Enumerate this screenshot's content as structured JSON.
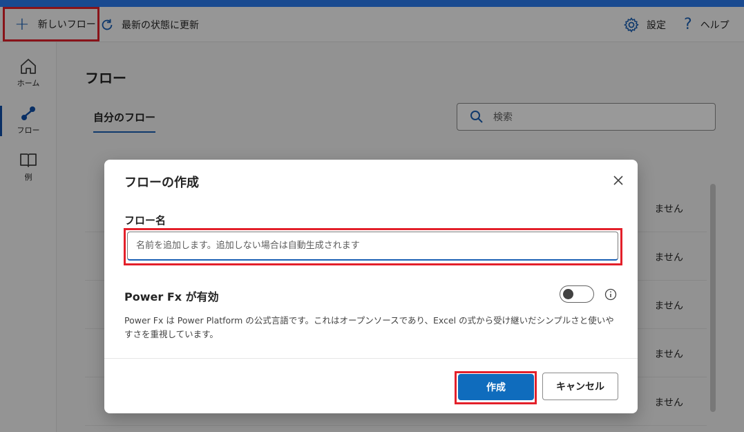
{
  "toolbar": {
    "new_flow_label": "新しいフロー",
    "refresh_label": "最新の状態に更新",
    "settings_label": "設定",
    "help_label": "ヘルプ"
  },
  "leftnav": {
    "items": [
      {
        "label": "ホーム",
        "icon": "home-icon"
      },
      {
        "label": "フロー",
        "icon": "flow-icon"
      },
      {
        "label": "例",
        "icon": "book-icon"
      }
    ],
    "active": "フロー"
  },
  "main": {
    "title": "フロー",
    "tab": "自分のフロー",
    "search_placeholder": "検索",
    "row_status_fragment": "ません"
  },
  "dialog": {
    "title": "フローの作成",
    "field_label": "フロー名",
    "name_value": "",
    "name_placeholder": "名前を追加します。追加しない場合は自動生成されます",
    "powerfx_label": "Power Fx が有効",
    "powerfx_enabled": false,
    "description": "Power Fx は Power Platform の公式言語です。これはオープンソースであり、Excel の式から受け継いだシンプルさと使いやすさを重視しています。",
    "create_label": "作成",
    "cancel_label": "キャンセル"
  },
  "colors": {
    "accent": "#2b7cf0",
    "primary": "#0f6cbd",
    "highlight": "#e3202a"
  }
}
